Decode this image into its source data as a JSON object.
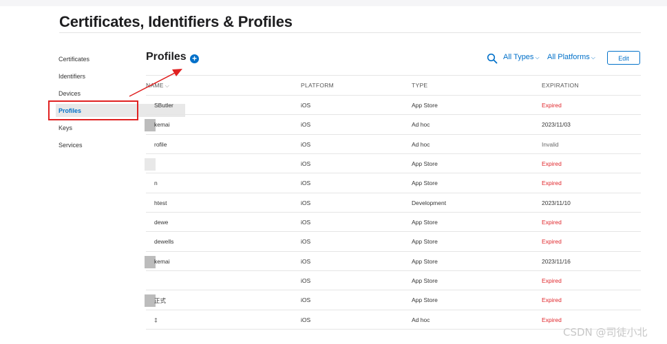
{
  "page": {
    "title": "Certificates, Identifiers & Profiles"
  },
  "sidebar": {
    "items": [
      {
        "label": "Certificates"
      },
      {
        "label": "Identifiers"
      },
      {
        "label": "Devices"
      },
      {
        "label": "Profiles",
        "active": true
      },
      {
        "label": "Keys"
      },
      {
        "label": "Services"
      }
    ]
  },
  "header": {
    "title": "Profiles",
    "add_icon": "plus-circle-icon",
    "search_icon": "search-icon",
    "type_filter": "All Types",
    "platform_filter": "All Platforms",
    "edit_label": "Edit"
  },
  "table": {
    "columns": [
      "NAME",
      "PLATFORM",
      "TYPE",
      "EXPIRATION"
    ],
    "rows": [
      {
        "name": "SButler",
        "platform": "iOS",
        "type": "App Store",
        "expiration": "Expired"
      },
      {
        "name": "kemai",
        "platform": "iOS",
        "type": "Ad hoc",
        "expiration": "2023/11/03"
      },
      {
        "name": "rofile",
        "platform": "iOS",
        "type": "Ad hoc",
        "expiration": "Invalid"
      },
      {
        "name": "",
        "platform": "iOS",
        "type": "App Store",
        "expiration": "Expired"
      },
      {
        "name": "n",
        "platform": "iOS",
        "type": "App Store",
        "expiration": "Expired"
      },
      {
        "name": "htest",
        "platform": "iOS",
        "type": "Development",
        "expiration": "2023/11/10"
      },
      {
        "name": "dewe",
        "platform": "iOS",
        "type": "App Store",
        "expiration": "Expired"
      },
      {
        "name": "dewells",
        "platform": "iOS",
        "type": "App Store",
        "expiration": "Expired"
      },
      {
        "name": "kemai",
        "platform": "iOS",
        "type": "App Store",
        "expiration": "2023/11/16"
      },
      {
        "name": "",
        "platform": "iOS",
        "type": "App Store",
        "expiration": "Expired"
      },
      {
        "name": "正式",
        "platform": "iOS",
        "type": "App Store",
        "expiration": "Expired"
      },
      {
        "name": "‡",
        "platform": "iOS",
        "type": "Ad hoc",
        "expiration": "Expired"
      }
    ]
  },
  "annotation": {
    "color": "#e02020"
  },
  "colors": {
    "accent": "#0070c9",
    "expired": "#e0262b"
  },
  "watermark": "CSDN @司徒小北"
}
